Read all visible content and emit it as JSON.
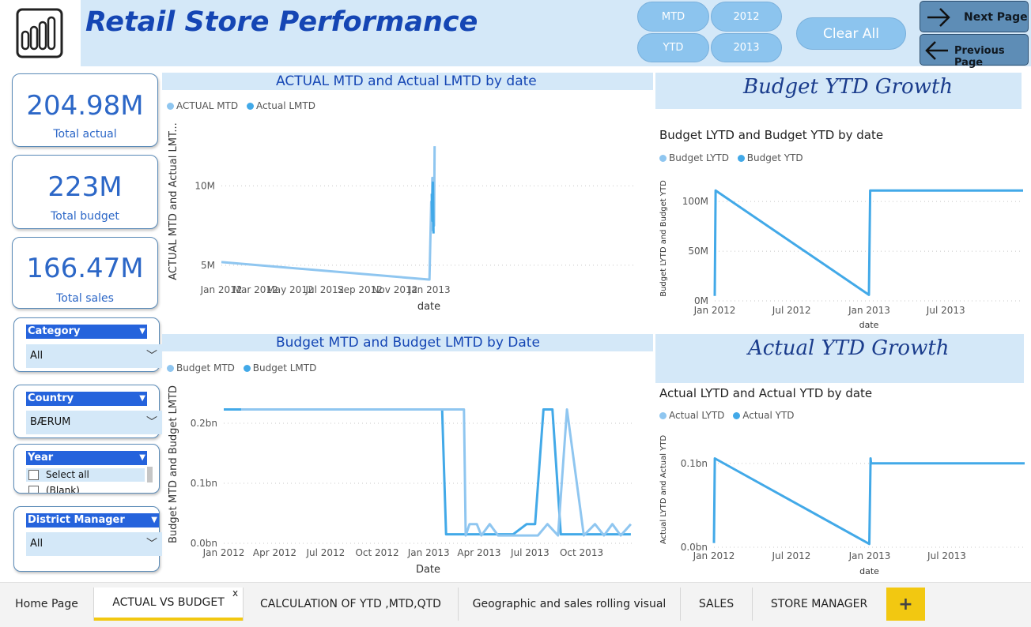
{
  "header": {
    "title": "Retail Store Performance",
    "logo_icon": "powerbi-logo-icon",
    "period_buttons": [
      "MTD",
      "YTD"
    ],
    "year_buttons": [
      "2012",
      "2013"
    ],
    "clear_all": "Clear All",
    "next_page": "Next Page",
    "previous_page": "Previous Page"
  },
  "kpis": [
    {
      "value": "204.98M",
      "label": "Total actual"
    },
    {
      "value": "223M",
      "label": "Total budget"
    },
    {
      "value": "166.47M",
      "label": "Total sales"
    }
  ],
  "slicers": {
    "category": {
      "title": "Category",
      "value": "All"
    },
    "country": {
      "title": "Country",
      "value": "BÆRUM"
    },
    "year": {
      "title": "Year",
      "option": "Select all",
      "option2": "(Blank)"
    },
    "district_manager": {
      "title": "District Manager",
      "value": "All"
    }
  },
  "colors": {
    "accent": "#1546b4",
    "series_light": "#8fc6f0",
    "series_dark": "#42a9e8",
    "band": "#d4e8f8",
    "tab_active": "#f2c811"
  },
  "chart_data": [
    {
      "type": "line",
      "title": "ACTUAL MTD and Actual LMTD by date",
      "xlabel": "date",
      "ylabel": "ACTUAL MTD and Actual LMT...",
      "series_names": [
        "ACTUAL MTD",
        "Actual LMTD"
      ],
      "x_ticks": [
        "Jan 2012",
        "Mar 2012",
        "May 2012",
        "Jul 2012",
        "Sep 2012",
        "Nov 2012",
        "Jan 2013"
      ],
      "y_ticks": [
        "5M",
        "10M"
      ],
      "ylim": [
        3.8,
        13.5
      ],
      "series": [
        {
          "name": "ACTUAL MTD",
          "points": [
            [
              "2012-01-01",
              5.2
            ],
            [
              "2012-12-31",
              4.1
            ],
            [
              "2013-01-01",
              4.1
            ],
            [
              "2013-01-04",
              9.0
            ],
            [
              "2013-01-05",
              8.5
            ],
            [
              "2013-01-06",
              10.5
            ],
            [
              "2013-01-07",
              7.2
            ],
            [
              "2013-01-08",
              9.2
            ],
            [
              "2013-01-09",
              7.5
            ],
            [
              "2013-01-10",
              12.5
            ]
          ]
        },
        {
          "name": "Actual LMTD",
          "points": [
            [
              "2013-01-05",
              9.5
            ],
            [
              "2013-01-06",
              7.8
            ],
            [
              "2013-01-07",
              10.2
            ],
            [
              "2013-01-08",
              7.0
            ]
          ]
        }
      ]
    },
    {
      "type": "line",
      "title": "Budget LYTD and Budget YTD by date",
      "band_title": "Budget YTD Growth",
      "xlabel": "date",
      "ylabel": "Budget LYTD and Budget YTD",
      "series_names": [
        "Budget LYTD",
        "Budget YTD"
      ],
      "x_ticks": [
        "Jan 2012",
        "Jul 2012",
        "Jan 2013",
        "Jul 2013"
      ],
      "y_ticks": [
        "0M",
        "50M",
        "100M"
      ],
      "ylim": [
        0,
        120
      ],
      "series": [
        {
          "name": "Budget YTD",
          "points": [
            [
              "2012-01-01",
              5
            ],
            [
              "2012-01-03",
              111
            ],
            [
              "2012-12-31",
              6
            ],
            [
              "2013-01-03",
              111
            ],
            [
              "2013-12-31",
              111
            ]
          ]
        }
      ]
    },
    {
      "type": "line",
      "title": "Budget MTD and Budget LMTD by Date",
      "xlabel": "Date",
      "ylabel": "Budget MTD and Budget LMTD",
      "series_names": [
        "Budget MTD",
        "Budget LMTD"
      ],
      "x_ticks": [
        "Jan 2012",
        "Apr 2012",
        "Jul 2012",
        "Oct 2012",
        "Jan 2013",
        "Apr 2013",
        "Jul 2013",
        "Oct 2013"
      ],
      "y_ticks": [
        "0.0bn",
        "0.1bn",
        "0.2bn"
      ],
      "ylim": [
        0,
        0.25
      ],
      "series": [
        {
          "name": "Budget LMTD",
          "points": [
            [
              "2012-01-01",
              0.223
            ],
            [
              "2013-01-25",
              0.223
            ],
            [
              "2013-02-01",
              0.015
            ],
            [
              "2013-04-10",
              0.015
            ],
            [
              "2013-06-01",
              0.015
            ],
            [
              "2013-06-25",
              0.032
            ],
            [
              "2013-07-10",
              0.032
            ],
            [
              "2013-07-25",
              0.223
            ],
            [
              "2013-08-10",
              0.223
            ],
            [
              "2013-08-25",
              0.015
            ],
            [
              "2013-12-28",
              0.015
            ]
          ]
        },
        {
          "name": "Budget MTD",
          "points": [
            [
              "2012-02-01",
              0.223
            ],
            [
              "2013-03-05",
              0.223
            ],
            [
              "2013-03-08",
              0.013
            ],
            [
              "2013-03-15",
              0.032
            ],
            [
              "2013-03-28",
              0.032
            ],
            [
              "2013-04-05",
              0.013
            ],
            [
              "2013-04-20",
              0.032
            ],
            [
              "2013-05-05",
              0.013
            ],
            [
              "2013-07-15",
              0.013
            ],
            [
              "2013-08-01",
              0.032
            ],
            [
              "2013-08-20",
              0.013
            ],
            [
              "2013-09-05",
              0.223
            ],
            [
              "2013-10-05",
              0.013
            ],
            [
              "2013-10-25",
              0.032
            ],
            [
              "2013-11-10",
              0.013
            ],
            [
              "2013-11-25",
              0.032
            ],
            [
              "2013-12-10",
              0.013
            ],
            [
              "2013-12-28",
              0.032
            ]
          ]
        }
      ]
    },
    {
      "type": "line",
      "title": "Actual LYTD and Actual YTD by date",
      "band_title": "Actual YTD Growth",
      "xlabel": "date",
      "ylabel": "Actual LYTD and Actual YTD",
      "series_names": [
        "Actual LYTD",
        "Actual YTD"
      ],
      "x_ticks": [
        "Jan 2012",
        "Jul 2012",
        "Jan 2013",
        "Jul 2013"
      ],
      "y_ticks": [
        "0.0bn",
        "0.1bn"
      ],
      "ylim": [
        0,
        0.13
      ],
      "series": [
        {
          "name": "Actual YTD",
          "points": [
            [
              "2012-01-01",
              0.005
            ],
            [
              "2012-01-03",
              0.106
            ],
            [
              "2012-12-31",
              0.004
            ],
            [
              "2013-01-03",
              0.106
            ],
            [
              "2013-01-04",
              0.1
            ],
            [
              "2013-12-31",
              0.1
            ]
          ]
        }
      ]
    }
  ],
  "tabs": [
    "Home Page",
    "ACTUAL VS BUDGET",
    "CALCULATION OF YTD ,MTD,QTD",
    "Geographic and sales rolling visual",
    "SALES",
    "STORE MANAGER"
  ],
  "tab_close": "x",
  "add_tab": "+"
}
